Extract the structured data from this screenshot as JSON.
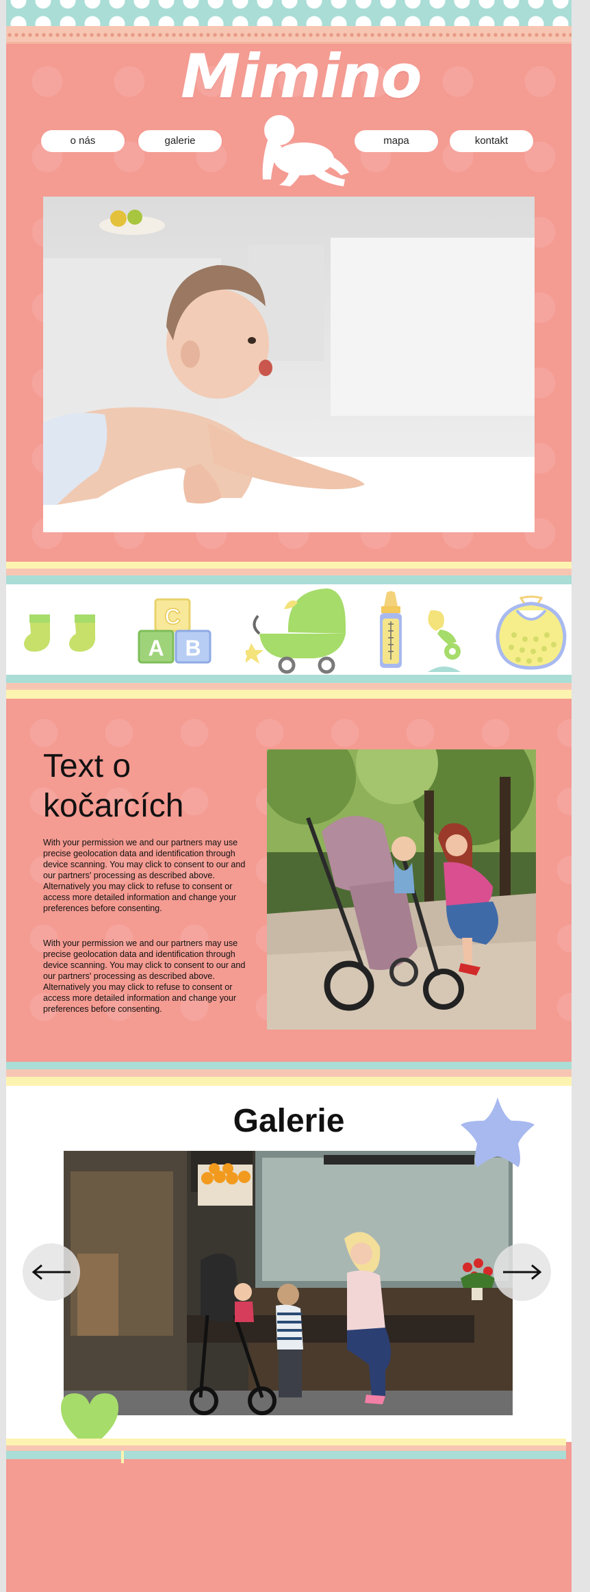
{
  "header": {
    "logo_text": "Mimino",
    "nav": {
      "about": "o nás",
      "gallery": "galerie",
      "map": "mapa",
      "contact": "kontakt"
    }
  },
  "stroller_section": {
    "title": "Text o kočarcích",
    "paragraphs": [
      "With your permission we and our partners may use precise geolocation data and identification through device scanning. You may click to consent to our and our partners' processing as described above. Alternatively you may click to refuse to consent or access more detailed information and change your preferences before consenting.",
      "With your permission we and our partners may use precise geolocation data and identification through device scanning. You may click to consent to our and our partners' processing as described above. Alternatively you may click to refuse to consent or access more detailed information and change your preferences before consenting."
    ]
  },
  "gallery": {
    "title": "Galerie",
    "prev_arrow": "←",
    "next_arrow": "→"
  },
  "colors": {
    "background": "#f49b92",
    "mint": "#a9ddd6",
    "pale_yellow": "#fdf3b0",
    "peach": "#f7c6b3",
    "star_blue": "#a8b9f0",
    "heart_green": "#a6dc6a"
  }
}
